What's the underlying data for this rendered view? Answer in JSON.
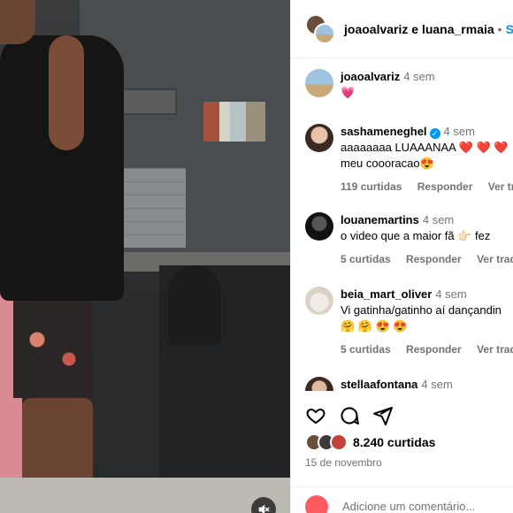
{
  "header": {
    "user1": "joaoalvariz",
    "connector": "e",
    "user2": "luana_rmaia",
    "separator": "•",
    "follow_label": "Seg"
  },
  "caption": {
    "user": "joaoalvariz",
    "time": "4 sem",
    "text": "💗"
  },
  "comments": [
    {
      "user": "sashameneghel",
      "verified": true,
      "time": "4 sem",
      "text_line1": "aaaaaaaa LUAAANAA ❤️ ❤️ ❤️",
      "text_line2": "meu coooracao😍",
      "likes": "119 curtidas",
      "reply": "Responder",
      "translate": "Ver tradu"
    },
    {
      "user": "louanemartins",
      "verified": false,
      "time": "4 sem",
      "text_line1": "o video que a maior fã 👉🏻 fez",
      "text_line2": "",
      "likes": "5 curtidas",
      "reply": "Responder",
      "translate": "Ver traduçã"
    },
    {
      "user": "beia_mart_oliver",
      "verified": false,
      "time": "4 sem",
      "text_line1": "Vi gatinha/gatinho aí dançandin",
      "text_line2": "🤗 🤗 😍 😍",
      "likes": "5 curtidas",
      "reply": "Responder",
      "translate": "Ver traduçã"
    },
    {
      "user": "stellaafontana",
      "verified": false,
      "time": "4 sem",
      "text_line1": "",
      "text_line2": "",
      "likes": "",
      "reply": "",
      "translate": ""
    }
  ],
  "post": {
    "like_count": "8.240 curtidas",
    "date": "15 de novembro",
    "comment_placeholder": "Adicione um comentário..."
  },
  "icons": {
    "like": "heart-icon",
    "comment": "comment-icon",
    "share": "share-icon",
    "mute": "muted-speaker-icon",
    "verified": "verified-badge-icon"
  },
  "colors": {
    "accent": "#0095f6",
    "muted_text": "#737373",
    "heart": "#e0245e"
  }
}
